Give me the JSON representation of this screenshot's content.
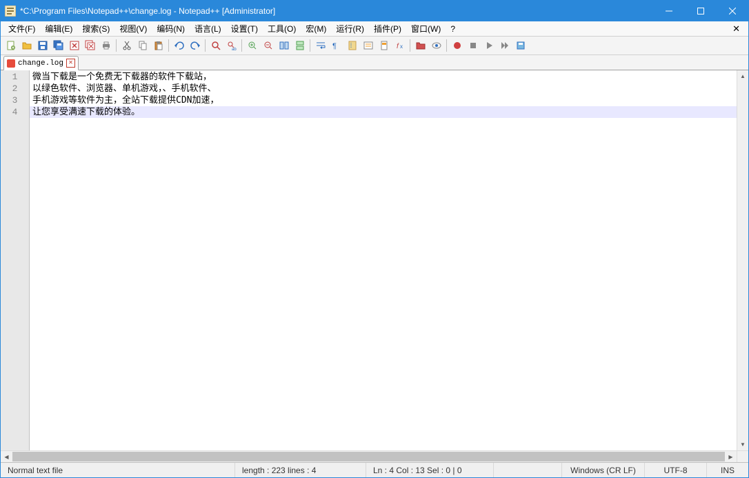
{
  "titlebar": {
    "title": "*C:\\Program Files\\Notepad++\\change.log - Notepad++ [Administrator]"
  },
  "menubar": {
    "file": "文件(F)",
    "edit": "编辑(E)",
    "search": "搜索(S)",
    "view": "视图(V)",
    "encoding": "编码(N)",
    "language": "语言(L)",
    "settings": "设置(T)",
    "tools": "工具(O)",
    "macro": "宏(M)",
    "run": "运行(R)",
    "plugins": "插件(P)",
    "window": "窗口(W)",
    "help": "?"
  },
  "tabs": {
    "0": {
      "label": "change.log"
    }
  },
  "editor": {
    "gutter": {
      "1": "1",
      "2": "2",
      "3": "3",
      "4": "4"
    },
    "lines": {
      "1": "微当下载是一个免费无下载器的软件下载站，",
      "2": "以绿色软件、浏览器、单机游戏，、手机软件、",
      "3": "手机游戏等软件为主，全站下载提供CDN加速，",
      "4": "让您享受满速下载的体验。"
    }
  },
  "status": {
    "filetype": "Normal text file",
    "length": "length : 223    lines : 4",
    "position": "Ln : 4    Col : 13    Sel : 0 | 0",
    "eol": "Windows (CR LF)",
    "encoding": "UTF-8",
    "insert": "INS"
  }
}
